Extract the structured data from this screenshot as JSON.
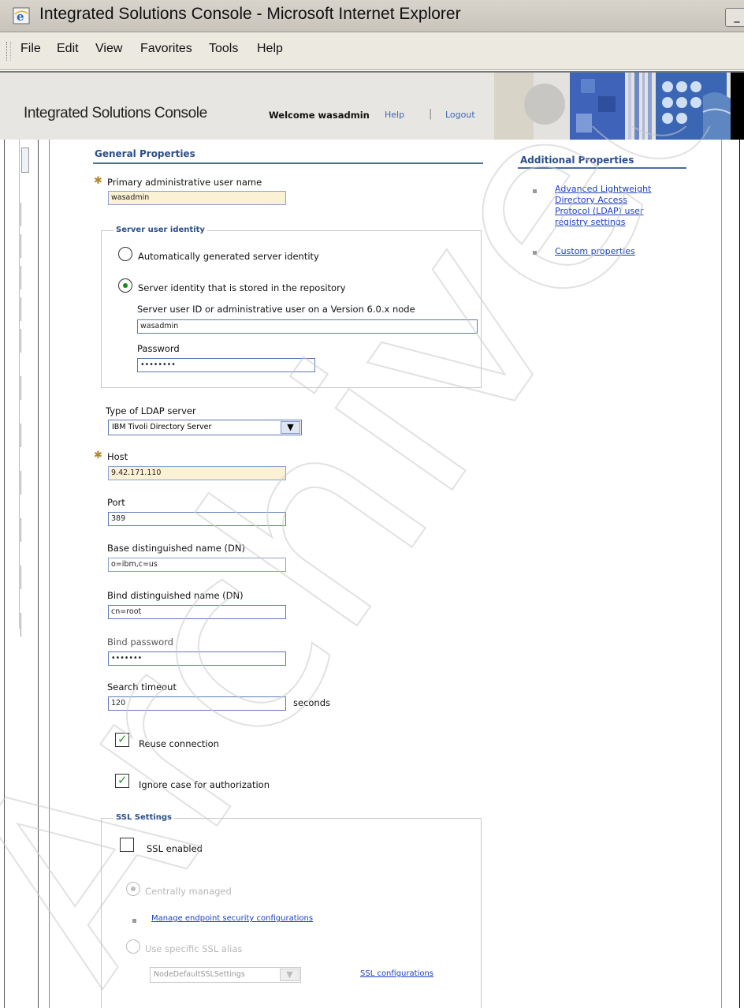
{
  "window": {
    "title": "Integrated Solutions Console - Microsoft Internet Explorer",
    "control_glyph": "_"
  },
  "menu": {
    "items": [
      "File",
      "Edit",
      "View",
      "Favorites",
      "Tools",
      "Help"
    ]
  },
  "banner": {
    "title": "Integrated Solutions Console",
    "welcome": "Welcome wasadmin",
    "help": "Help",
    "separator": "|",
    "logout": "Logout"
  },
  "general": {
    "heading": "General Properties",
    "primary_user_label": "Primary administrative user name",
    "primary_user_value": "wasadmin",
    "server_identity": {
      "legend": "Server user identity",
      "auto_label": "Automatically generated server identity",
      "stored_label": "Server identity that is stored in the repository",
      "userid_label": "Server user ID or administrative user on a Version 6.0.x node",
      "userid_value": "wasadmin",
      "password_label": "Password",
      "password_value": "••••••••"
    },
    "ldap_type_label": "Type of LDAP server",
    "ldap_type_value": "IBM Tivoli Directory Server",
    "host_label": "Host",
    "host_value": "9.42.171.110",
    "port_label": "Port",
    "port_value": "389",
    "base_dn_label": "Base distinguished name (DN)",
    "base_dn_value": "o=ibm,c=us",
    "bind_dn_label": "Bind distinguished name (DN)",
    "bind_dn_value": "cn=root",
    "bind_password_label": "Bind password",
    "bind_password_value": "•••••••",
    "search_timeout_label": "Search timeout",
    "search_timeout_value": "120",
    "search_timeout_unit": "seconds",
    "reuse_connection_label": "Reuse connection",
    "ignore_case_label": "Ignore case for authorization",
    "ssl": {
      "legend": "SSL Settings",
      "enabled_label": "SSL enabled",
      "centrally_managed_label": "Centrally managed",
      "manage_endpoint_link": "Manage endpoint security configurations",
      "specific_alias_label": "Use specific SSL alias",
      "alias_value": "NodeDefaultSSLSettings",
      "ssl_config_link": "SSL configurations"
    }
  },
  "additional": {
    "heading": "Additional Properties",
    "links": [
      "Advanced Lightweight",
      "Directory Access",
      "Protocol (LDAP) user",
      "registry settings",
      "Custom properties"
    ]
  },
  "state": {
    "server_identity_selected": "stored",
    "reuse_connection": true,
    "ignore_case": true,
    "ssl_enabled": false,
    "ssl_mode_selected": "centrally_managed"
  },
  "icons": [
    "ie-icon",
    "required-star-icon",
    "chevron-down-icon",
    "checkmark-icon",
    "bullet-icon"
  ],
  "watermark": "Archived"
}
